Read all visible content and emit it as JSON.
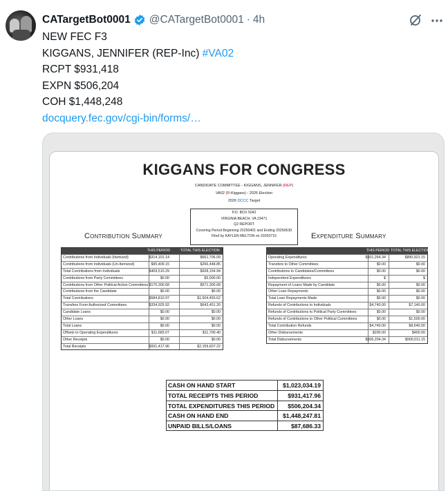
{
  "post": {
    "author_name": "CATargetBot0001",
    "handle": "@CATargetBot0001",
    "separator": "·",
    "time": "4h",
    "lines": {
      "l1": "NEW FEC F3",
      "l2": "KIGGANS, JENNIFER (REP-Inc) ",
      "hashtag": "#VA02",
      "l3": "RCPT $931,418",
      "l4": "EXPN $506,204",
      "l5": "COH $1,448,248",
      "link": "docquery.fec.gov/cgi-bin/forms/…"
    },
    "icons": {
      "verified": "verified-badge-icon",
      "grok": "grok-icon",
      "more": "more-icon"
    },
    "colors": {
      "accent": "#1d9bf0",
      "text": "#0f1419",
      "muted": "#536471"
    }
  },
  "report": {
    "title": "KIGGANS FOR CONGRESS",
    "committee": {
      "prefix": "CANDIDATE COMMITTEE - KIGGANS, JENNIFER (",
      "party": "REP",
      "suffix": ")"
    },
    "race": {
      "prefix": "VA02 (",
      "party": "R",
      "suffix": "-Kiggans) - 2026 Election"
    },
    "target": {
      "prefix": "2026 ",
      "org": "DCCC",
      "suffix": " Target"
    },
    "address": [
      "P.O. BOX 5042",
      "VIRGINIA BEACH, VA 23471",
      "Q2 REPORT",
      "Covering Period Beginning 20250401 and Ending 20250630",
      "Filed by KAYLEN MELTON on 20250715"
    ],
    "contribution_summary": {
      "title": "Contribution Summary",
      "col1": "THIS PERIOD",
      "col2": "TOTAL THIS ELECTION",
      "rows": [
        {
          "label": "Contributions from Individuals (Itemized)",
          "period": "$314,101.14",
          "total": "$661,706.09"
        },
        {
          "label": "Contributions from Individuals (Un-Itemized)",
          "period": "$95,409.15",
          "total": "$266,448.85"
        },
        {
          "label": "Total Contributions from Individuals",
          "period": "$409,510.29",
          "total": "$928,154.94"
        },
        {
          "label": "Contributions from Party Committees",
          "period": "$0.00",
          "total": "$5,000.00"
        },
        {
          "label": "Contributions from Other Political Action Committees",
          "period": "$175,300.68",
          "total": "$571,300.68"
        },
        {
          "label": "Contributions from the Candidate",
          "period": "$0.00",
          "total": "$0.00"
        },
        {
          "label": "Total Contributions",
          "period": "$584,810.97",
          "total": "$1,504,455.62"
        },
        {
          "label": "Transfers From Authorized Committees",
          "period": "$334,925.92",
          "total": "$643,451.20"
        },
        {
          "label": "Candidate Loans",
          "period": "$0.00",
          "total": "$0.00"
        },
        {
          "label": "Other Loans",
          "period": "$0.00",
          "total": "$0.00"
        },
        {
          "label": "Total Loans",
          "period": "$0.00",
          "total": "$0.00"
        },
        {
          "label": "Offsets to Operating Expenditures",
          "period": "$11,683.07",
          "total": "$11,700.40"
        },
        {
          "label": "Other Receipts",
          "period": "$0.00",
          "total": "$0.00"
        },
        {
          "label": "Total Receipts",
          "period": "$931,417.96",
          "total": "$2,159,607.22"
        }
      ]
    },
    "expenditure_summary": {
      "title": "Expenditure Summary",
      "col1": "THIS PERIOD",
      "col2": "TOTAL THIS ELECTION",
      "rows": [
        {
          "label": "Operating Expenditures",
          "period": "$501,264.34",
          "total": "$890,921.15"
        },
        {
          "label": "Transfers to Other Committees",
          "period": "$0.00",
          "total": "$0.00"
        },
        {
          "label": "Contributions to Candidates/Committees",
          "period": "$0.00",
          "total": "$0.00"
        },
        {
          "label": "Independent Expenditures",
          "period": "$",
          "total": "$"
        },
        {
          "label": "Repayment of Loans Made by Candidate",
          "period": "$0.00",
          "total": "$0.00"
        },
        {
          "label": "Other Loan Repayments",
          "period": "$0.00",
          "total": "$0.00"
        },
        {
          "label": "Total Loan Repayments Made",
          "period": "$0.00",
          "total": "$0.00"
        },
        {
          "label": "Refunds of Contributions to Individuals",
          "period": "$4,740.00",
          "total": "$7,140.00"
        },
        {
          "label": "Refunds of Contributions to Political Party Committees",
          "period": "$0.00",
          "total": "$0.00"
        },
        {
          "label": "Refunds of Contributions to Other Political Committees",
          "period": "$0.00",
          "total": "$1,500.00"
        },
        {
          "label": "Total Contribution Refunds",
          "period": "$4,740.00",
          "total": "$8,640.00"
        },
        {
          "label": "Other Disbursements",
          "period": "$200.00",
          "total": "$450.00"
        },
        {
          "label": "Total Disbursements",
          "period": "$506,204.34",
          "total": "$900,011.15"
        }
      ]
    },
    "cash_summary": [
      {
        "label": "CASH ON HAND START",
        "value": "$1,023,034.19"
      },
      {
        "label": "TOTAL RECEIPTS THIS PERIOD",
        "value": "$931,417.96"
      },
      {
        "label": "TOTAL EXPENDITURES THIS PERIOD",
        "value": "$506,204.34"
      },
      {
        "label": "CASH ON HAND END",
        "value": "$1,448,247.81"
      },
      {
        "label": "UNPAID BILLS/LOANS",
        "value": "$87,686.33"
      }
    ]
  }
}
